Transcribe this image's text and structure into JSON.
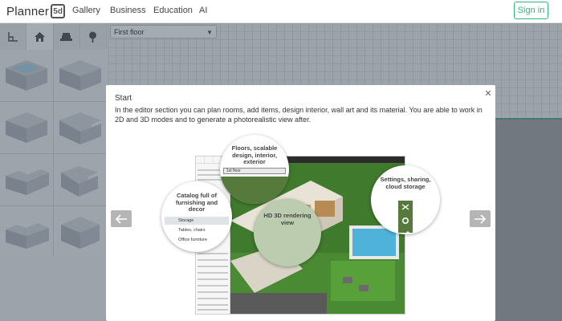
{
  "nav": {
    "logo_text": "Planner",
    "logo_badge": "5d",
    "links": [
      "Gallery",
      "Business",
      "Education",
      "AI"
    ],
    "signin_label": "Sign in"
  },
  "sidebar": {
    "tabs": [
      "plan-icon",
      "house-icon",
      "sofa-icon",
      "tree-icon"
    ],
    "rooms": [
      "rectangular-room",
      "rectangular-room",
      "rectangular-room",
      "cornered-room",
      "l-shaped-room",
      "l-shaped-room",
      "t-shaped-room",
      "box-room"
    ]
  },
  "canvas": {
    "floor_select": "First floor"
  },
  "modal": {
    "title": "Start",
    "body": "In the editor section you can plan rooms, add items, design interior, wall art and its material. You are able to work in 2D and 3D modes and to generate a photorealistic view after.",
    "close_icon": "close-icon",
    "prev_icon": "arrow-left-icon",
    "next_icon": "arrow-right-icon"
  },
  "preview": {
    "floors_label": "Floors, scalable design, interior, exterior",
    "floor_select": "1st floor",
    "catalog_label": "Catalog full of furnishing and decor",
    "catalog_items": [
      "Storage",
      "Tables, chairs",
      "Office furniture"
    ],
    "hd_label": "HD 3D rendering view",
    "settings_label": "Settings, sharing, cloud storage"
  },
  "colors": {
    "accent": "#2eb87a",
    "lawn": "#3f7a2d",
    "pool": "#4fb3d9"
  }
}
